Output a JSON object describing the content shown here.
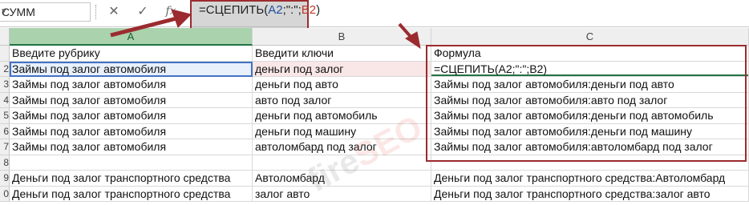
{
  "namebox": {
    "value": "СУММ",
    "dropdown_icon": "chevron-down-icon"
  },
  "formula_bar": {
    "cancel_icon": "✕",
    "enter_icon": "✓",
    "fx_label": "fx",
    "formula_parts": [
      {
        "text": "=СЦЕПИТЬ(",
        "color": "#222222"
      },
      {
        "text": "A2",
        "color": "#1f4e9e"
      },
      {
        "text": ";\":\";",
        "color": "#222222"
      },
      {
        "text": "B2",
        "color": "#c0392b"
      },
      {
        "text": ")",
        "color": "#222222"
      }
    ]
  },
  "columns": [
    "A",
    "B",
    "C"
  ],
  "rows": [
    {
      "num": "",
      "a": "Введите рубрику",
      "b": "Введити ключи",
      "c": "Формула"
    },
    {
      "num": "2",
      "a": "Займы под залог автомобиля",
      "b": "деньги под залог",
      "c": "=СЦЕПИТЬ(A2;\":\";B2)"
    },
    {
      "num": "3",
      "a": "Займы под залог автомобиля",
      "b": "деньги под авто",
      "c": "Займы под залог автомобиля:деньги под авто"
    },
    {
      "num": "4",
      "a": "Займы под залог автомобиля",
      "b": "авто под залог",
      "c": "Займы под залог автомобиля:авто под залог"
    },
    {
      "num": "5",
      "a": "Займы под залог автомобиля",
      "b": "деньги под автомобиль",
      "c": "Займы под залог автомобиля:деньги под автомобиль"
    },
    {
      "num": "6",
      "a": "Займы под залог автомобиля",
      "b": "деньги под машину",
      "c": "Займы под залог автомобиля:деньги под машину"
    },
    {
      "num": "7",
      "a": "Займы под залог автомобиля",
      "b": "автоломбард под залог",
      "c": "Займы под залог автомобиля:автоломбард под залог"
    },
    {
      "num": "8",
      "a": "",
      "b": "",
      "c": ""
    },
    {
      "num": "9",
      "a": "Деньги под залог транспортного средства",
      "b": "Автоломбард",
      "c": "Деньги под залог транспортного средства:Автоломбард"
    },
    {
      "num": "0",
      "a": "Деньги под залог транспортного средства",
      "b": "залог авто",
      "c": "Деньги под залог транспортного средства:залог авто"
    }
  ],
  "watermark": {
    "text": "fireSEO",
    "prefix": "fire",
    "suffix": "SEO"
  },
  "colors": {
    "annotation": "#9b2b2f",
    "selected_column": "#a9d2ad",
    "active_border": "#217346"
  }
}
